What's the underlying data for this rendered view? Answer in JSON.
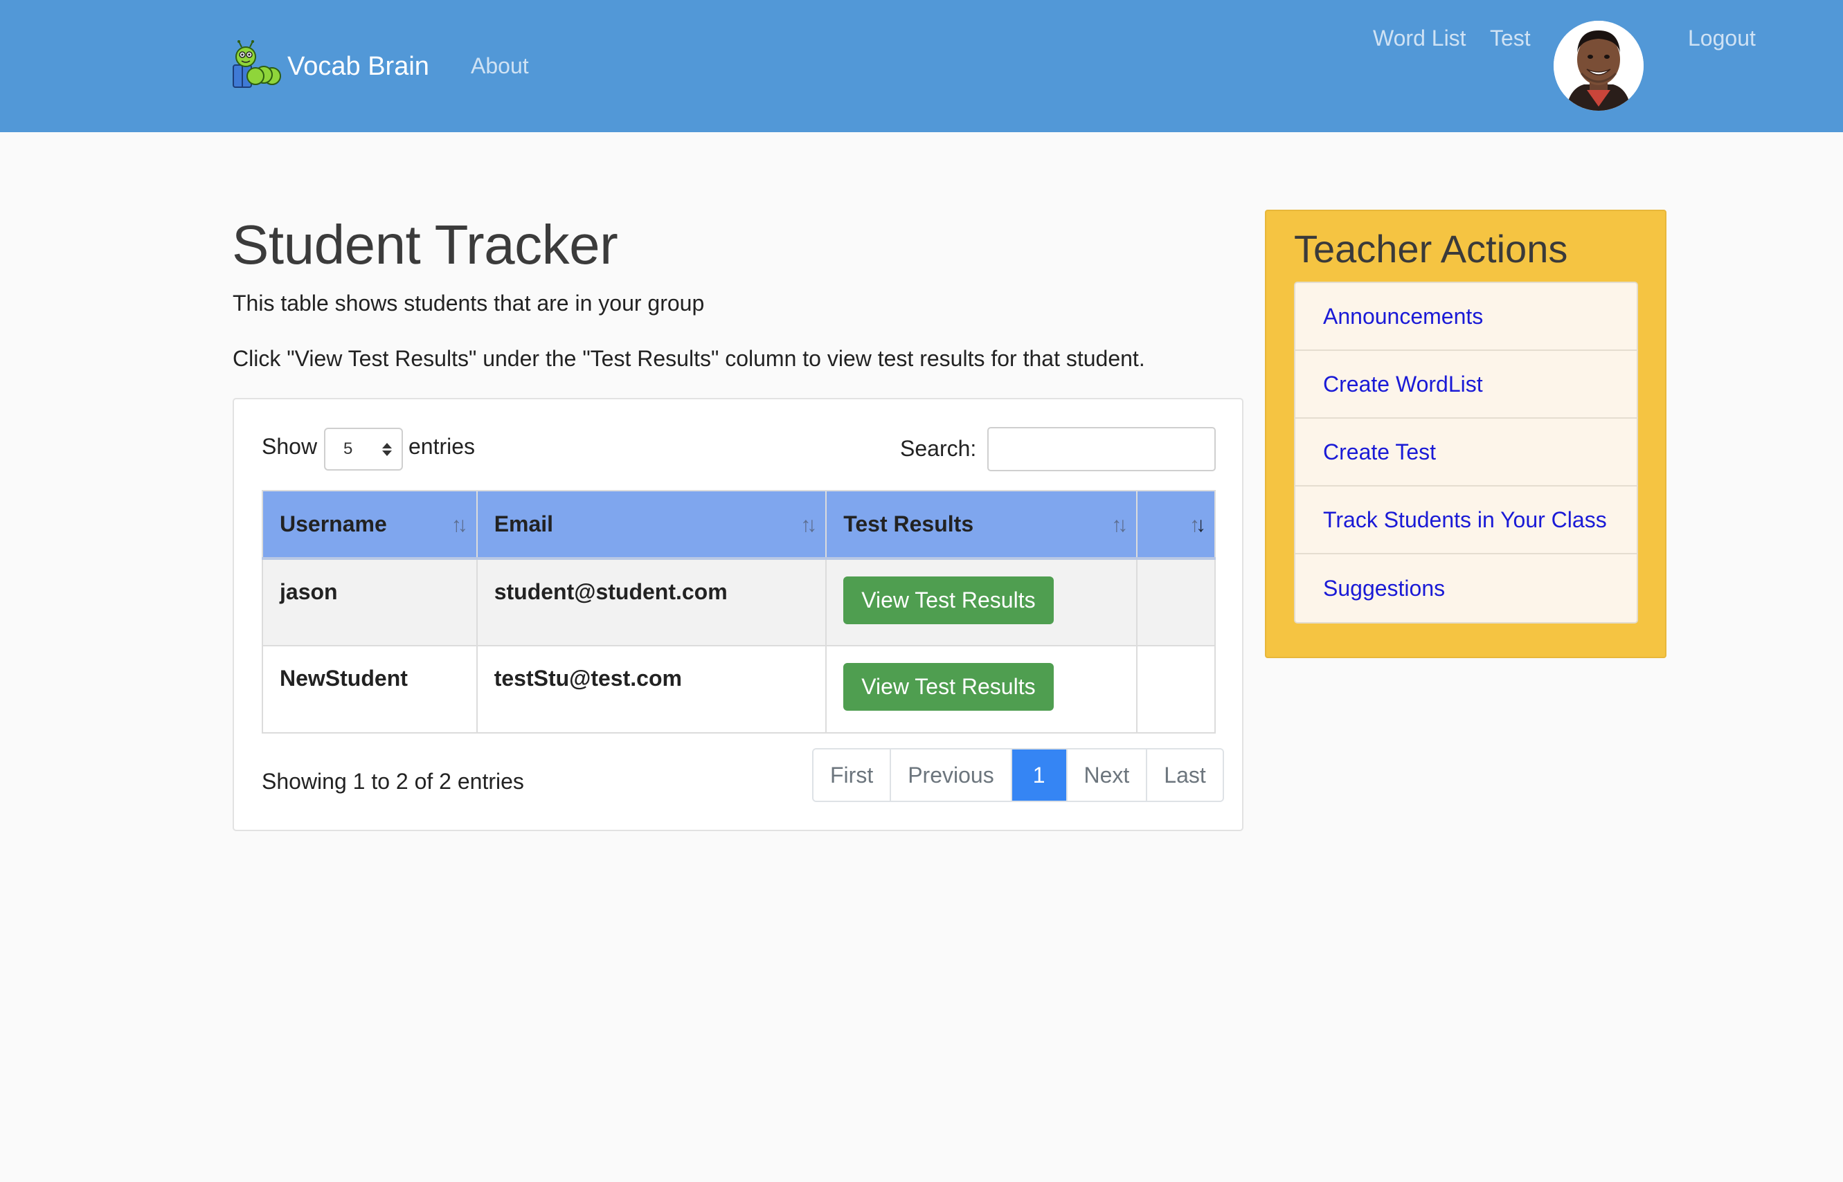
{
  "navbar": {
    "brand_name": "Vocab Brain",
    "about": "About",
    "word_list": "Word List",
    "test": "Test",
    "logout": "Logout",
    "background_color": "#5298d7"
  },
  "main": {
    "title": "Student Tracker",
    "intro_line_1": "This table shows students that are in your group",
    "intro_line_2": "Click \"View Test Results\" under the \"Test Results\" column to view test results for that student.",
    "length_control": {
      "show_label": "Show",
      "selected_value": "5",
      "entries_label": "entries"
    },
    "search": {
      "label": "Search:",
      "value": "",
      "placeholder": ""
    },
    "table": {
      "columns": [
        "Username",
        "Email",
        "Test Results",
        ""
      ],
      "rows": [
        {
          "username": "jason",
          "email": "student@student.com",
          "action": "View Test Results"
        },
        {
          "username": "NewStudent",
          "email": "testStu@test.com",
          "action": "View Test Results"
        }
      ],
      "header_color": "#7fa6ee",
      "button_color": "#4f9e50"
    },
    "info": "Showing 1 to 2 of 2 entries",
    "pagination": {
      "first": "First",
      "previous": "Previous",
      "current_page": "1",
      "next": "Next",
      "last": "Last",
      "active_color": "#3585f4"
    }
  },
  "sidebar": {
    "title": "Teacher Actions",
    "items": [
      {
        "label": "Announcements"
      },
      {
        "label": "Create WordList"
      },
      {
        "label": "Create Test"
      },
      {
        "label": "Track Students in Your Class"
      },
      {
        "label": "Suggestions"
      }
    ],
    "background_color": "#f5c442",
    "link_color": "#1a1ad6"
  },
  "icons": {
    "logo": "caterpillar-reading-logo",
    "avatar": "user-avatar-photo",
    "sort": "sort-arrows-icon",
    "select": "select-arrows-icon"
  }
}
